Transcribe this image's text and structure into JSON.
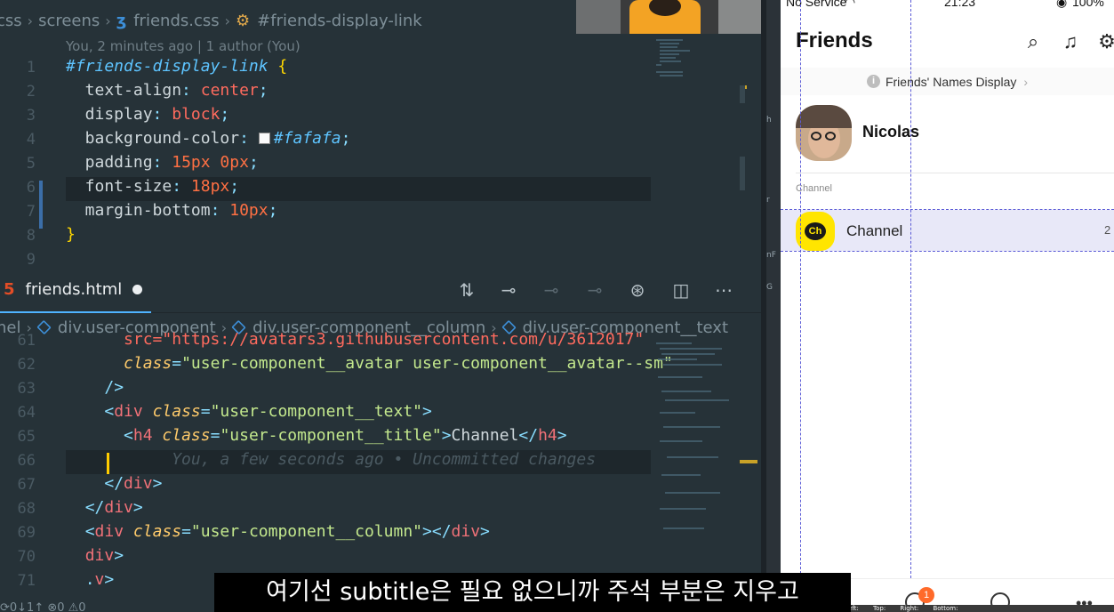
{
  "top_breadcrumb": {
    "items": [
      "css",
      "screens",
      "friends.css",
      "#friends-display-link"
    ]
  },
  "blame": "You, 2 minutes ago | 1 author (You)",
  "css_lines": [
    {
      "n": "1",
      "parts": [
        [
          "sel",
          "#friends-display-link"
        ],
        [
          "p",
          " "
        ],
        [
          "br",
          "{"
        ]
      ]
    },
    {
      "n": "2",
      "parts": [
        [
          "p",
          "  text-align"
        ],
        [
          "pun",
          ": "
        ],
        [
          "val",
          "center"
        ],
        [
          "pun",
          ";"
        ]
      ]
    },
    {
      "n": "3",
      "parts": [
        [
          "p",
          "  display"
        ],
        [
          "pun",
          ": "
        ],
        [
          "val",
          "block"
        ],
        [
          "pun",
          ";"
        ]
      ]
    },
    {
      "n": "4",
      "parts": [
        [
          "p",
          "  background-color"
        ],
        [
          "pun",
          ": "
        ],
        [
          "sw",
          ""
        ],
        [
          "sel2",
          "#fafafa"
        ],
        [
          "pun",
          ";"
        ]
      ]
    },
    {
      "n": "5",
      "parts": [
        [
          "p",
          "  padding"
        ],
        [
          "pun",
          ": "
        ],
        [
          "num",
          "15px 0px"
        ],
        [
          "pun",
          ";"
        ]
      ]
    },
    {
      "n": "6",
      "parts": [
        [
          "p",
          "  font-size"
        ],
        [
          "pun",
          ": "
        ],
        [
          "num",
          "18px"
        ],
        [
          "pun",
          ";"
        ]
      ]
    },
    {
      "n": "7",
      "parts": [
        [
          "p",
          "  margin-bottom"
        ],
        [
          "pun",
          ": "
        ],
        [
          "num",
          "10px"
        ],
        [
          "pun",
          ";"
        ]
      ]
    },
    {
      "n": "8",
      "parts": [
        [
          "br",
          "}"
        ]
      ]
    },
    {
      "n": "9",
      "parts": []
    }
  ],
  "tab": {
    "file": "friends.html"
  },
  "tab_icons": [
    "compare-changes-icon",
    "previous-change-icon",
    "circle-dot-icon",
    "next-change-icon",
    "source-control-icon",
    "split-editor-icon",
    "more-actions-icon"
  ],
  "html_breadcrumb": {
    "items": [
      "nel",
      "div.user-component",
      "div.user-component__column",
      "div.user-component__text"
    ]
  },
  "html_lines": [
    {
      "n": "61",
      "text": "      src=\"https://avatars3.githubusercontent.com/u/3612017\""
    },
    {
      "n": "62",
      "parts": [
        [
          "p",
          "      "
        ],
        [
          "attr",
          "class"
        ],
        [
          "pun",
          "="
        ],
        [
          "str",
          "\"user-component__avatar user-component__avatar--sm\""
        ]
      ]
    },
    {
      "n": "63",
      "parts": [
        [
          "p",
          "    "
        ],
        [
          "pun",
          "/>"
        ]
      ]
    },
    {
      "n": "64",
      "parts": [
        [
          "p",
          "    "
        ],
        [
          "pun",
          "<"
        ],
        [
          "tag",
          "div"
        ],
        [
          "p",
          " "
        ],
        [
          "attr",
          "class"
        ],
        [
          "pun",
          "="
        ],
        [
          "str",
          "\"user-component__text\""
        ],
        [
          "pun",
          ">"
        ]
      ]
    },
    {
      "n": "65",
      "parts": [
        [
          "p",
          "      "
        ],
        [
          "pun",
          "<"
        ],
        [
          "tag",
          "h4"
        ],
        [
          "p",
          " "
        ],
        [
          "attr",
          "class"
        ],
        [
          "pun",
          "="
        ],
        [
          "str",
          "\"user-component__title\""
        ],
        [
          "pun",
          ">"
        ],
        [
          "p",
          "Channel"
        ],
        [
          "pun",
          "</"
        ],
        [
          "tag",
          "h4"
        ],
        [
          "pun",
          ">"
        ]
      ]
    },
    {
      "n": "66",
      "parts": [
        [
          "p",
          "      "
        ],
        [
          "ghost",
          "     You, a few seconds ago • Uncommitted changes"
        ]
      ]
    },
    {
      "n": "67",
      "parts": [
        [
          "p",
          "    "
        ],
        [
          "pun",
          "</"
        ],
        [
          "tag",
          "div"
        ],
        [
          "pun",
          ">"
        ]
      ]
    },
    {
      "n": "68",
      "parts": [
        [
          "p",
          "  "
        ],
        [
          "pun",
          "</"
        ],
        [
          "tag",
          "div"
        ],
        [
          "pun",
          ">"
        ]
      ]
    },
    {
      "n": "69",
      "parts": [
        [
          "p",
          "  "
        ],
        [
          "pun",
          "<"
        ],
        [
          "tag",
          "div"
        ],
        [
          "p",
          " "
        ],
        [
          "attr",
          "class"
        ],
        [
          "pun",
          "="
        ],
        [
          "str",
          "\"user-component__column\""
        ],
        [
          "pun",
          "></"
        ],
        [
          "tag",
          "div"
        ],
        [
          "pun",
          ">"
        ]
      ]
    },
    {
      "n": "70",
      "parts": [
        [
          "p",
          "  "
        ],
        [
          "tag",
          "div"
        ],
        [
          "pun",
          ">"
        ]
      ]
    },
    {
      "n": "71",
      "parts": [
        [
          "p",
          "  "
        ],
        [
          "pun",
          "."
        ],
        [
          "tag",
          "v"
        ],
        [
          "pun",
          ">"
        ]
      ]
    }
  ],
  "statusbar": "⟳0↓1↑   ⊗0 ⚠0",
  "phone": {
    "status_left": "No Service",
    "status_time": "21:23",
    "status_right": "100%",
    "title": "Friends",
    "display_link": "Friends' Names Display",
    "display_link_chevron": "›",
    "user_name": "Nicolas",
    "section_title": "Channel",
    "channel_avatar_text": "Ch",
    "channel_name": "Channel",
    "channel_count": "2",
    "badge": "1",
    "dev_labels": [
      "eft:",
      "Top:",
      "Right:",
      "Bottom:"
    ]
  },
  "subtitle": "여기선 subtitle은 필요 없으니까 주석 부분은 지우고",
  "colors": {
    "editor_bg": "#263238",
    "accent": "#4fb3ff",
    "channel_yellow": "#ffe500",
    "badge_orange": "#ff6a2a"
  }
}
